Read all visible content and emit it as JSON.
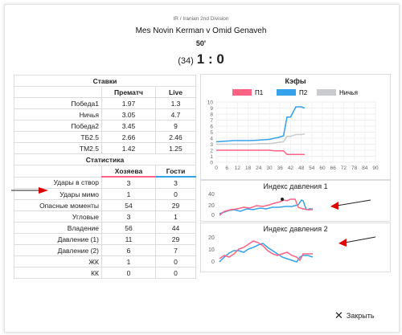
{
  "header": {
    "league": "IR / Iranian 2nd Division",
    "match": "Mes Novin Kerman v Omid Genaveh",
    "minute": "50'",
    "score_small": "(34)",
    "score": "1 : 0"
  },
  "odds": {
    "title": "Ставки",
    "col1": "Прематч",
    "col2": "Live",
    "rows": [
      {
        "label": "Победа1",
        "pre": "1.97",
        "live": "1.3"
      },
      {
        "label": "Ничья",
        "pre": "3.05",
        "live": "4.7"
      },
      {
        "label": "Победа2",
        "pre": "3.45",
        "live": "9"
      },
      {
        "label": "ТБ2.5",
        "pre": "2.66",
        "live": "2.46"
      },
      {
        "label": "ТМ2.5",
        "pre": "1.42",
        "live": "1.25"
      }
    ]
  },
  "stats": {
    "title": "Статистика",
    "col1": "Хозяева",
    "col2": "Гости",
    "rows": [
      {
        "label": "Удары в створ",
        "home": "3",
        "away": "3"
      },
      {
        "label": "Удары мимо",
        "home": "1",
        "away": "0"
      },
      {
        "label": "Опасные моменты",
        "home": "54",
        "away": "29"
      },
      {
        "label": "Угловые",
        "home": "3",
        "away": "1"
      },
      {
        "label": "Владение",
        "home": "56",
        "away": "44"
      },
      {
        "label": "Давление (1)",
        "home": "11",
        "away": "29"
      },
      {
        "label": "Давление (2)",
        "home": "6",
        "away": "7"
      },
      {
        "label": "ЖК",
        "home": "1",
        "away": "0"
      },
      {
        "label": "КК",
        "home": "0",
        "away": "0"
      }
    ]
  },
  "charts": {
    "odds_chart": {
      "title": "Кэфы",
      "legend": [
        "П1",
        "П2",
        "Ничья"
      ],
      "colors": [
        "#ff6384",
        "#36a2eb",
        "#c9cbcf"
      ],
      "x_ticks": [
        "0",
        "6",
        "12",
        "18",
        "24",
        "30",
        "36",
        "42",
        "48",
        "54",
        "60",
        "66",
        "72",
        "78",
        "84",
        "90"
      ],
      "y_ticks": [
        "0",
        "1",
        "2",
        "3",
        "4",
        "5",
        "6",
        "7",
        "8",
        "9",
        "10"
      ]
    },
    "pressure1": {
      "title": "Индекс давления 1",
      "y_ticks": [
        "0",
        "20",
        "40"
      ]
    },
    "pressure2": {
      "title": "Индекс давления 2",
      "y_ticks": [
        "0",
        "10",
        "20"
      ]
    }
  },
  "chart_data": [
    {
      "type": "line",
      "title": "Кэфы",
      "x": [
        0,
        5,
        10,
        15,
        20,
        25,
        30,
        33,
        35,
        38,
        40,
        42,
        45,
        48,
        50
      ],
      "series": [
        {
          "name": "П1",
          "values": [
            2.0,
            2.0,
            2.0,
            2.0,
            2.0,
            2.0,
            2.0,
            1.9,
            1.9,
            1.9,
            1.3,
            1.3,
            1.3,
            1.3,
            1.3
          ]
        },
        {
          "name": "П2",
          "values": [
            3.4,
            3.5,
            3.6,
            3.6,
            3.6,
            3.7,
            3.8,
            4.0,
            4.1,
            4.4,
            7.5,
            7.5,
            9.2,
            9.2,
            9.0
          ]
        },
        {
          "name": "Ничья",
          "values": [
            3.0,
            3.0,
            3.0,
            3.0,
            3.0,
            3.1,
            3.1,
            3.2,
            3.3,
            3.4,
            4.3,
            4.3,
            4.6,
            4.6,
            4.7
          ]
        }
      ],
      "xlim": [
        0,
        90
      ],
      "ylim": [
        0,
        10
      ]
    }
  ],
  "close_label": "Закрыть"
}
